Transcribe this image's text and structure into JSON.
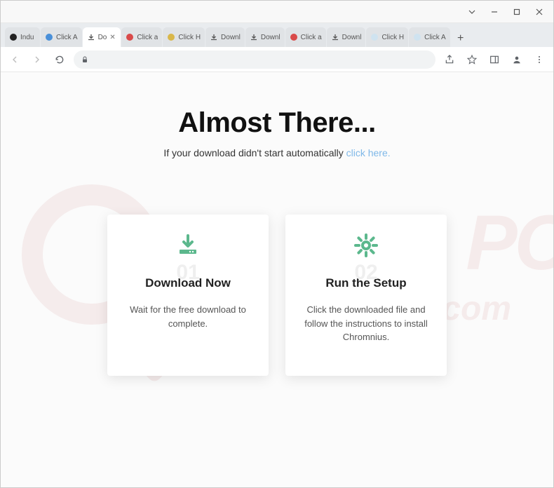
{
  "window": {
    "tabs": [
      {
        "label": "Indu",
        "icon": "globe-black"
      },
      {
        "label": "Click A",
        "icon": "circle-blue"
      },
      {
        "label": "Do",
        "icon": "download",
        "active": true
      },
      {
        "label": "Click a",
        "icon": "circle-red"
      },
      {
        "label": "Click H",
        "icon": "circle-yellow"
      },
      {
        "label": "Downl",
        "icon": "download"
      },
      {
        "label": "Downl",
        "icon": "download"
      },
      {
        "label": "Click a",
        "icon": "circle-red"
      },
      {
        "label": "Downl",
        "icon": "download"
      },
      {
        "label": "Click H",
        "icon": "circle-light"
      },
      {
        "label": "Click A",
        "icon": "circle-light"
      }
    ]
  },
  "page": {
    "title": "Almost There...",
    "subtitle_prefix": "If your download didn't start automatically ",
    "subtitle_link": "click here.",
    "cards": [
      {
        "number": "01",
        "title": "Download Now",
        "desc": "Wait for the free download to complete."
      },
      {
        "number": "02",
        "title": "Run the Setup",
        "desc": "Click the downloaded file and follow the instructions to install Chromnius."
      }
    ]
  }
}
